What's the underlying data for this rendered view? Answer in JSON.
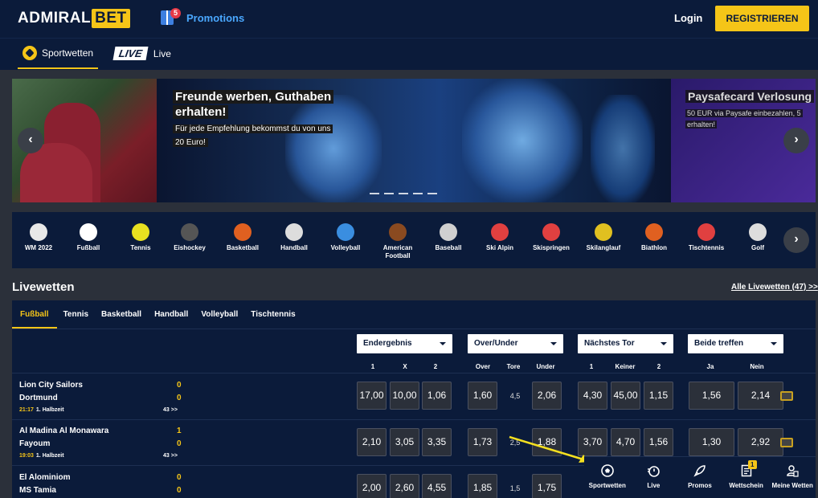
{
  "header": {
    "logo_admiral": "ADMIRAL",
    "logo_bet": "BET",
    "promotions_count": "5",
    "promotions_label": "Promotions",
    "login_label": "Login",
    "register_label": "REGISTRIEREN"
  },
  "nav": {
    "sportwetten_label": "Sportwetten",
    "live_logo": "LIVE",
    "live_label": "Live"
  },
  "banner": {
    "title": "Freunde werben, Guthaben erhalten!",
    "subtitle": "Für jede Empfehlung bekommst du von uns 20 Euro!",
    "right_title": "Paysafecard Verlosung",
    "right_subtitle": "50 EUR via Paysafe einbezahlen, 5 erhalten!",
    "prev_arrow": "‹",
    "next_arrow": "›"
  },
  "sports": {
    "items": [
      {
        "label": "WM 2022",
        "icon": "wm-2022-icon",
        "color": "#e8e8e8"
      },
      {
        "label": "Fußball",
        "icon": "football-icon",
        "color": "#ffffff"
      },
      {
        "label": "Tennis",
        "icon": "tennis-icon",
        "color": "#e8e020"
      },
      {
        "label": "Eishockey",
        "icon": "ice-hockey-icon",
        "color": "#555555"
      },
      {
        "label": "Basketball",
        "icon": "basketball-icon",
        "color": "#e06020"
      },
      {
        "label": "Handball",
        "icon": "handball-icon",
        "color": "#dddddd"
      },
      {
        "label": "Volleyball",
        "icon": "volleyball-icon",
        "color": "#3a8ee0"
      },
      {
        "label": "American Football",
        "icon": "american-football-icon",
        "color": "#8a4a20"
      },
      {
        "label": "Baseball",
        "icon": "baseball-icon",
        "color": "#d0d0d0"
      },
      {
        "label": "Ski Alpin",
        "icon": "ski-alpin-icon",
        "color": "#e04040"
      },
      {
        "label": "Skispringen",
        "icon": "ski-jumping-icon",
        "color": "#e04040"
      },
      {
        "label": "Skilanglauf",
        "icon": "cross-country-ski-icon",
        "color": "#e0c020"
      },
      {
        "label": "Biathlon",
        "icon": "biathlon-icon",
        "color": "#e06020"
      },
      {
        "label": "Tischtennis",
        "icon": "table-tennis-icon",
        "color": "#e04040"
      },
      {
        "label": "Golf",
        "icon": "golf-icon",
        "color": "#dddddd"
      }
    ],
    "next_arrow": "›"
  },
  "livewetten": {
    "title": "Livewetten",
    "all_link": "Alle Livewetten (47) >>",
    "tabs": [
      "Fußball",
      "Tennis",
      "Basketball",
      "Handball",
      "Volleyball",
      "Tischtennis"
    ],
    "markets": [
      "Endergebnis",
      "Over/Under",
      "Nächstes Tor",
      "Beide treffen"
    ],
    "columns": [
      "1",
      "X",
      "2",
      "Over",
      "Tore",
      "Under",
      "1",
      "Keiner",
      "2",
      "Ja",
      "Nein"
    ],
    "matches": [
      {
        "home": "Lion City Sailors",
        "away": "Dortmund",
        "home_score": "0",
        "away_score": "0",
        "time": "21:17",
        "period": "1. Halbzeit",
        "more": "43 >>",
        "odds_1x2": [
          "17,00",
          "10,00",
          "1,06"
        ],
        "over": "1,60",
        "tore": "4,5",
        "under": "2,06",
        "next_goal": [
          "4,30",
          "45,00",
          "1,15"
        ],
        "btts": [
          "1,56",
          "2,14"
        ]
      },
      {
        "home": "Al Madina Al Monawara",
        "away": "Fayoum",
        "home_score": "1",
        "away_score": "0",
        "time": "19:03",
        "period": "1. Halbzeit",
        "more": "43 >>",
        "odds_1x2": [
          "2,10",
          "3,05",
          "3,35"
        ],
        "over": "1,73",
        "tore": "2,5",
        "under": "1,88",
        "next_goal": [
          "3,70",
          "4,70",
          "1,56"
        ],
        "btts": [
          "1,30",
          "2,92"
        ]
      },
      {
        "home": "El Alominiom",
        "away": "MS Tamia",
        "home_score": "0",
        "away_score": "0",
        "odds_1x2": [
          "2,00",
          "2,60",
          "4,55"
        ],
        "over": "1,85",
        "tore": "1,5",
        "under": "1,75"
      }
    ]
  },
  "bottom_nav": {
    "items": [
      {
        "label": "Sportwetten",
        "icon": "football-icon"
      },
      {
        "label": "Live",
        "icon": "live-stopwatch-icon"
      },
      {
        "label": "Promos",
        "icon": "rocket-icon"
      },
      {
        "label": "Wettschein",
        "icon": "betslip-icon",
        "badge": "1"
      },
      {
        "label": "Meine Wetten",
        "icon": "my-bets-icon"
      }
    ]
  },
  "colors": {
    "accent": "#f5c518",
    "navy": "#0b1b3a",
    "background": "#2b303a",
    "link": "#4aa8ff"
  }
}
